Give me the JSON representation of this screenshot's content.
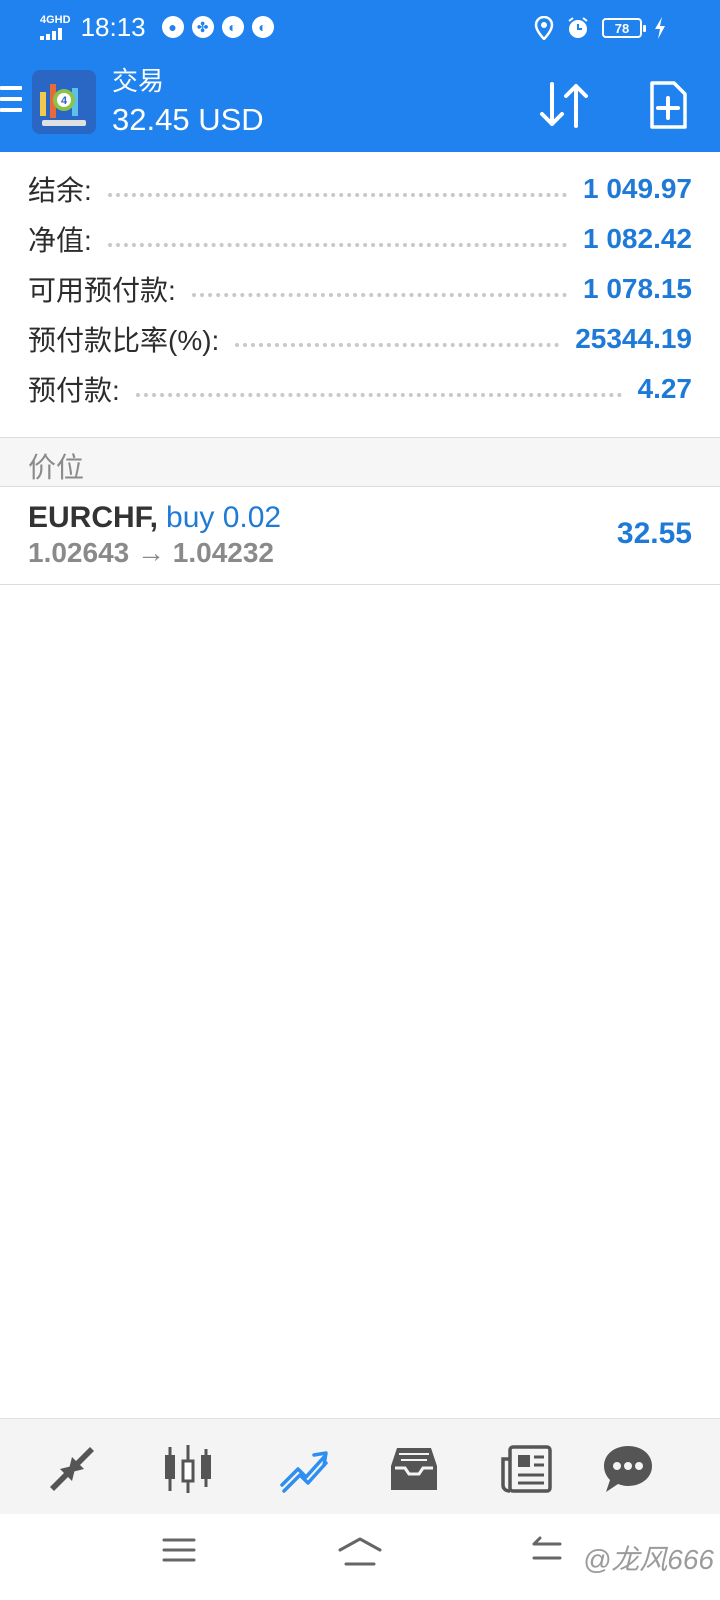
{
  "status_bar": {
    "network": "4GHD",
    "time": "18:13",
    "battery": "78"
  },
  "app_bar": {
    "title": "交易",
    "balance": "32.45 USD"
  },
  "summary": [
    {
      "label": "结余:",
      "value": "1 049.97"
    },
    {
      "label": "净值:",
      "value": "1 082.42"
    },
    {
      "label": "可用预付款:",
      "value": "1 078.15"
    },
    {
      "label": "预付款比率(%):",
      "value": "25344.19"
    },
    {
      "label": "预付款:",
      "value": "4.27"
    }
  ],
  "section": {
    "title": "价位"
  },
  "positions": [
    {
      "symbol": "EURCHF,",
      "type": "buy 0.02",
      "prices": "1.02643 → 1.04232",
      "profit": "32.55"
    }
  ],
  "tabs": [
    {
      "icon": "quotes-icon"
    },
    {
      "icon": "chart-icon"
    },
    {
      "icon": "trade-icon",
      "active": true
    },
    {
      "icon": "history-icon"
    },
    {
      "icon": "news-icon"
    },
    {
      "icon": "chat-icon"
    }
  ],
  "watermark": "@龙风666",
  "colors": {
    "brand_blue": "#1f82ee",
    "value_blue": "#1f7ad7",
    "active_tab": "#2f8ff0",
    "inactive_tab": "#555555"
  }
}
